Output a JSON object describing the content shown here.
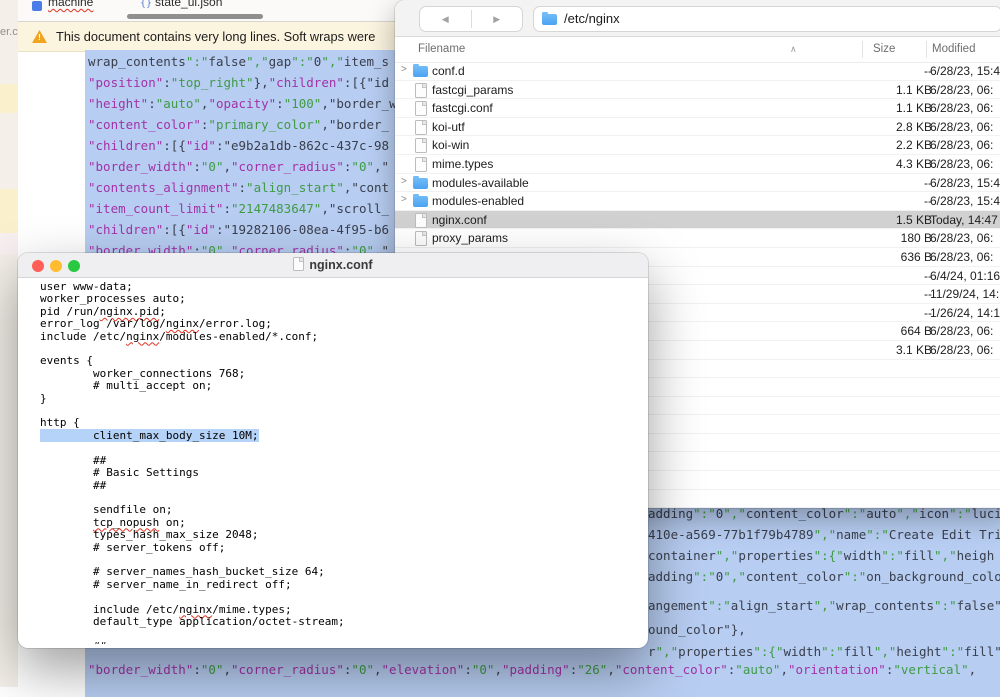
{
  "desktop": {
    "text": "er.c"
  },
  "colors": {
    "sel": "#b7cdf1",
    "key": "#a233a8",
    "val": "#3f9b45",
    "punct": "#3a3f4d",
    "hl": "#b5d3f8",
    "warn-bg": "#fbf4df",
    "warn-icon": "#f0a41f",
    "folder": "#55a9f2",
    "light-red": "#ff5f57",
    "light-yellow": "#febc2e",
    "light-green": "#28c840"
  },
  "editor": {
    "tabs": [
      {
        "label": "machine",
        "icon": "blue-square-icon",
        "misspelled": true
      },
      {
        "label": "state_ui.json",
        "icon": "braces-icon",
        "misspelled": false
      }
    ],
    "warning": "This document contains very long lines. Soft wraps were",
    "top_lines": [
      "wrap_contents\":\"false\",\"gap\":\"0\",\"item_s",
      "\"position\":\"top_right\"},\"children\":[{\"id",
      "\"height\":\"auto\",\"opacity\":\"100\",\"border_w",
      "\"content_color\":\"primary_color\",\"border_",
      "\"children\":[{\"id\":\"e9b2a1db-862c-437c-98",
      "\"border_width\":\"0\",\"corner_radius\":\"0\",\"",
      "\"contents_alignment\":\"align_start\",\"cont",
      "\"item_count_limit\":\"2147483647\",\"scroll_",
      "\"children\":[{\"id\":\"19282106-08ea-4f95-b6",
      "\"border_width\":\"0\",\"corner_radius\":\"0\",\""
    ],
    "right_lines": [
      "adding\":\"0\",\"content_color\":\"auto\",\"icon\":\"luci",
      "410e-a569-77b1f79b4789\",\"name\":\"Create Edit Tri",
      "container\",\"properties\":{\"width\":\"fill\",\"heigh",
      "adding\":\"0\",\"content_color\":\"on_background_colo",
      "angement\":\"align_start\",\"wrap_contents\":\"false\"",
      "ound_color\"},",
      "r\",\"properties\":{\"width\":\"fill\",\"height\":\"fill\""
    ],
    "bottom_line": "\"border_width\":\"0\",\"corner_radius\":\"0\",\"elevation\":\"0\",\"padding\":\"26\",\"content_color\":\"auto\",\"orientation\":\"vertical\","
  },
  "finder": {
    "path": "/etc/nginx",
    "columns": [
      "Filename",
      "Size",
      "Modified"
    ],
    "sort_indicator": "∧",
    "back_glyph": "◀",
    "forward_glyph": "▶",
    "rows": [
      {
        "name": "conf.d",
        "kind": "folder",
        "size": "--",
        "modified": "6/28/23, 15:4",
        "selected": false
      },
      {
        "name": "fastcgi_params",
        "kind": "file",
        "size": "1.1 KB",
        "modified": "6/28/23, 06:",
        "selected": false
      },
      {
        "name": "fastcgi.conf",
        "kind": "file",
        "size": "1.1 KB",
        "modified": "6/28/23, 06:",
        "selected": false
      },
      {
        "name": "koi-utf",
        "kind": "file",
        "size": "2.8 KB",
        "modified": "6/28/23, 06:",
        "selected": false
      },
      {
        "name": "koi-win",
        "kind": "file",
        "size": "2.2 KB",
        "modified": "6/28/23, 06:",
        "selected": false
      },
      {
        "name": "mime.types",
        "kind": "file",
        "size": "4.3 KB",
        "modified": "6/28/23, 06:",
        "selected": false
      },
      {
        "name": "modules-available",
        "kind": "folder",
        "size": "--",
        "modified": "6/28/23, 15:4",
        "selected": false
      },
      {
        "name": "modules-enabled",
        "kind": "folder",
        "size": "--",
        "modified": "6/28/23, 15:4",
        "selected": false
      },
      {
        "name": "nginx.conf",
        "kind": "file",
        "size": "1.5 KB",
        "modified": "Today, 14:47",
        "selected": true
      },
      {
        "name": "proxy_params",
        "kind": "file",
        "size": "180 B",
        "modified": "6/28/23, 06:",
        "selected": false
      },
      {
        "name": "",
        "kind": "hidden",
        "size": "636 B",
        "modified": "6/28/23, 06:",
        "selected": false
      },
      {
        "name": "",
        "kind": "hidden",
        "size": "--",
        "modified": "6/4/24, 01:16",
        "selected": false
      },
      {
        "name": "",
        "kind": "hidden",
        "size": "--",
        "modified": "11/29/24, 14:",
        "selected": false
      },
      {
        "name": "",
        "kind": "hidden",
        "size": "--",
        "modified": "1/26/24, 14:1",
        "selected": false
      },
      {
        "name": "",
        "kind": "hidden",
        "size": "664 B",
        "modified": "6/28/23, 06:",
        "selected": false
      },
      {
        "name": "",
        "kind": "hidden",
        "size": "3.1 KB",
        "modified": "6/28/23, 06:",
        "selected": false
      }
    ],
    "empty_filler_rows": 8
  },
  "viewer": {
    "title": "nginx.conf",
    "highlight_index": 12,
    "misspelled": [
      "nginx.pid",
      "tcp_nopush",
      "nginx"
    ],
    "lines": [
      "user www-data;",
      "worker_processes auto;",
      "pid /run/nginx.pid;",
      "error_log /var/log/nginx/error.log;",
      "include /etc/nginx/modules-enabled/*.conf;",
      "",
      "events {",
      "        worker_connections 768;",
      "        # multi_accept on;",
      "}",
      "",
      "http {",
      "        client_max_body_size 10M;",
      "",
      "        ##",
      "        # Basic Settings",
      "        ##",
      "",
      "        sendfile on;",
      "        tcp_nopush on;",
      "        types_hash_max_size 2048;",
      "        # server_tokens off;",
      "",
      "        # server_names_hash_bucket_size 64;",
      "        # server_name_in_redirect off;",
      "",
      "        include /etc/nginx/mime.types;",
      "        default_type application/octet-stream;",
      "",
      "        ##"
    ]
  }
}
